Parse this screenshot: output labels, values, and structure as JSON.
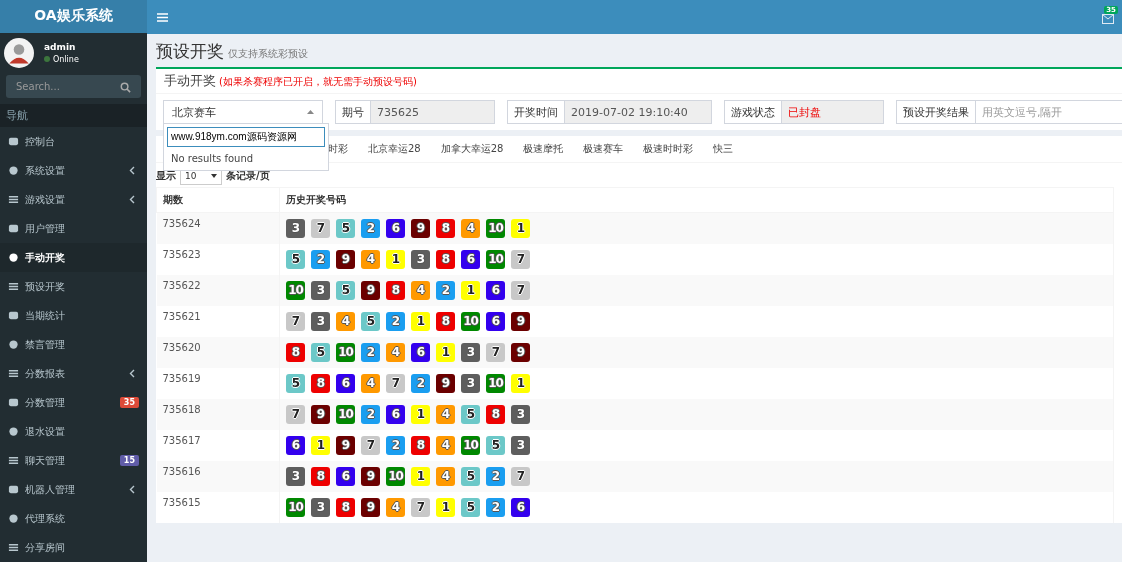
{
  "app": {
    "logo": "OA娱乐系统",
    "mail_badge": "35"
  },
  "user": {
    "name": "admin",
    "status": "Online"
  },
  "sidebar": {
    "search_placeholder": "Search...",
    "heading": "导航",
    "items": [
      {
        "label": "控制台",
        "selected": false,
        "submenu": false
      },
      {
        "label": "系统设置",
        "selected": false,
        "submenu": true
      },
      {
        "label": "游戏设置",
        "selected": false,
        "submenu": true
      },
      {
        "label": "用户管理",
        "selected": false,
        "submenu": false
      },
      {
        "label": "手动开奖",
        "selected": true,
        "submenu": false
      },
      {
        "label": "预设开奖",
        "selected": false,
        "submenu": false
      },
      {
        "label": "当期统计",
        "selected": false,
        "submenu": false
      },
      {
        "label": "禁言管理",
        "selected": false,
        "submenu": false
      },
      {
        "label": "分数报表",
        "selected": false,
        "submenu": true
      },
      {
        "label": "分数管理",
        "selected": false,
        "submenu": false,
        "badge": "35",
        "color": "#dd4b39"
      },
      {
        "label": "退水设置",
        "selected": false,
        "submenu": false
      },
      {
        "label": "聊天管理",
        "selected": false,
        "submenu": false,
        "badge": "15",
        "color": "#605ca8"
      },
      {
        "label": "机器人管理",
        "selected": false,
        "submenu": true
      },
      {
        "label": "代理系统",
        "selected": false,
        "submenu": false
      },
      {
        "label": "分享房间",
        "selected": false,
        "submenu": false
      }
    ]
  },
  "page": {
    "title": "预设开奖",
    "subtitle": "仅支持系统彩预设"
  },
  "box": {
    "title": "手动开奖",
    "note": "(如果杀赛程序已开启，就无需手动预设号码)",
    "game_select": {
      "value": "北京赛车",
      "expanded": true,
      "search_value": "www.918ym.com源码资源网",
      "empty_text": "No results found"
    },
    "fields": [
      {
        "label": "期号",
        "value": "735625",
        "kind": "readonly"
      },
      {
        "label": "开奖时间",
        "value": "2019-07-02 19:10:40",
        "kind": "readonly"
      },
      {
        "label": "游戏状态",
        "value": "已封盘",
        "kind": "status"
      },
      {
        "label": "预设开奖结果",
        "placeholder": "用英文逗号,隔开",
        "kind": "input"
      }
    ]
  },
  "tabs": [
    "时彩",
    "北京幸运28",
    "加拿大幸运28",
    "极速摩托",
    "极速赛车",
    "极速时时彩",
    "快三"
  ],
  "page_size": {
    "prefix": "显示",
    "value": "10",
    "suffix": "条记录/页"
  },
  "table": {
    "columns": [
      "期数",
      "历史开奖号码"
    ],
    "rows": [
      {
        "period": "735624",
        "balls": [
          {
            "n": "3",
            "color": "#5e5e5e"
          },
          {
            "n": "7",
            "color": "#c8c8c8"
          },
          {
            "n": "5",
            "color": "#6cc8c8"
          },
          {
            "n": "2",
            "color": "#1a9ef0"
          },
          {
            "n": "6",
            "color": "#3300ee"
          },
          {
            "n": "9",
            "color": "#6b0000"
          },
          {
            "n": "8",
            "color": "#ee0000"
          },
          {
            "n": "4",
            "color": "#ff9900"
          },
          {
            "n": "10",
            "color": "#008800"
          },
          {
            "n": "1",
            "color": "#ffff00"
          }
        ]
      },
      {
        "period": "735623",
        "balls": [
          {
            "n": "5",
            "color": "#6cc8c8"
          },
          {
            "n": "2",
            "color": "#1a9ef0"
          },
          {
            "n": "9",
            "color": "#6b0000"
          },
          {
            "n": "4",
            "color": "#ff9900"
          },
          {
            "n": "1",
            "color": "#ffff00"
          },
          {
            "n": "3",
            "color": "#5e5e5e"
          },
          {
            "n": "8",
            "color": "#ee0000"
          },
          {
            "n": "6",
            "color": "#3300ee"
          },
          {
            "n": "10",
            "color": "#008800"
          },
          {
            "n": "7",
            "color": "#c8c8c8"
          }
        ]
      },
      {
        "period": "735622",
        "balls": [
          {
            "n": "10",
            "color": "#008800"
          },
          {
            "n": "3",
            "color": "#5e5e5e"
          },
          {
            "n": "5",
            "color": "#6cc8c8"
          },
          {
            "n": "9",
            "color": "#6b0000"
          },
          {
            "n": "8",
            "color": "#ee0000"
          },
          {
            "n": "4",
            "color": "#ff9900"
          },
          {
            "n": "2",
            "color": "#1a9ef0"
          },
          {
            "n": "1",
            "color": "#ffff00"
          },
          {
            "n": "6",
            "color": "#3300ee"
          },
          {
            "n": "7",
            "color": "#c8c8c8"
          }
        ]
      },
      {
        "period": "735621",
        "balls": [
          {
            "n": "7",
            "color": "#c8c8c8"
          },
          {
            "n": "3",
            "color": "#5e5e5e"
          },
          {
            "n": "4",
            "color": "#ff9900"
          },
          {
            "n": "5",
            "color": "#6cc8c8"
          },
          {
            "n": "2",
            "color": "#1a9ef0"
          },
          {
            "n": "1",
            "color": "#ffff00"
          },
          {
            "n": "8",
            "color": "#ee0000"
          },
          {
            "n": "10",
            "color": "#008800"
          },
          {
            "n": "6",
            "color": "#3300ee"
          },
          {
            "n": "9",
            "color": "#6b0000"
          }
        ]
      },
      {
        "period": "735620",
        "balls": [
          {
            "n": "8",
            "color": "#ee0000"
          },
          {
            "n": "5",
            "color": "#6cc8c8"
          },
          {
            "n": "10",
            "color": "#008800"
          },
          {
            "n": "2",
            "color": "#1a9ef0"
          },
          {
            "n": "4",
            "color": "#ff9900"
          },
          {
            "n": "6",
            "color": "#3300ee"
          },
          {
            "n": "1",
            "color": "#ffff00"
          },
          {
            "n": "3",
            "color": "#5e5e5e"
          },
          {
            "n": "7",
            "color": "#c8c8c8"
          },
          {
            "n": "9",
            "color": "#6b0000"
          }
        ]
      },
      {
        "period": "735619",
        "balls": [
          {
            "n": "5",
            "color": "#6cc8c8"
          },
          {
            "n": "8",
            "color": "#ee0000"
          },
          {
            "n": "6",
            "color": "#3300ee"
          },
          {
            "n": "4",
            "color": "#ff9900"
          },
          {
            "n": "7",
            "color": "#c8c8c8"
          },
          {
            "n": "2",
            "color": "#1a9ef0"
          },
          {
            "n": "9",
            "color": "#6b0000"
          },
          {
            "n": "3",
            "color": "#5e5e5e"
          },
          {
            "n": "10",
            "color": "#008800"
          },
          {
            "n": "1",
            "color": "#ffff00"
          }
        ]
      },
      {
        "period": "735618",
        "balls": [
          {
            "n": "7",
            "color": "#c8c8c8"
          },
          {
            "n": "9",
            "color": "#6b0000"
          },
          {
            "n": "10",
            "color": "#008800"
          },
          {
            "n": "2",
            "color": "#1a9ef0"
          },
          {
            "n": "6",
            "color": "#3300ee"
          },
          {
            "n": "1",
            "color": "#ffff00"
          },
          {
            "n": "4",
            "color": "#ff9900"
          },
          {
            "n": "5",
            "color": "#6cc8c8"
          },
          {
            "n": "8",
            "color": "#ee0000"
          },
          {
            "n": "3",
            "color": "#5e5e5e"
          }
        ]
      },
      {
        "period": "735617",
        "balls": [
          {
            "n": "6",
            "color": "#3300ee"
          },
          {
            "n": "1",
            "color": "#ffff00"
          },
          {
            "n": "9",
            "color": "#6b0000"
          },
          {
            "n": "7",
            "color": "#c8c8c8"
          },
          {
            "n": "2",
            "color": "#1a9ef0"
          },
          {
            "n": "8",
            "color": "#ee0000"
          },
          {
            "n": "4",
            "color": "#ff9900"
          },
          {
            "n": "10",
            "color": "#008800"
          },
          {
            "n": "5",
            "color": "#6cc8c8"
          },
          {
            "n": "3",
            "color": "#5e5e5e"
          }
        ]
      },
      {
        "period": "735616",
        "balls": [
          {
            "n": "3",
            "color": "#5e5e5e"
          },
          {
            "n": "8",
            "color": "#ee0000"
          },
          {
            "n": "6",
            "color": "#3300ee"
          },
          {
            "n": "9",
            "color": "#6b0000"
          },
          {
            "n": "10",
            "color": "#008800"
          },
          {
            "n": "1",
            "color": "#ffff00"
          },
          {
            "n": "4",
            "color": "#ff9900"
          },
          {
            "n": "5",
            "color": "#6cc8c8"
          },
          {
            "n": "2",
            "color": "#1a9ef0"
          },
          {
            "n": "7",
            "color": "#c8c8c8"
          }
        ]
      },
      {
        "period": "735615",
        "balls": [
          {
            "n": "10",
            "color": "#008800"
          },
          {
            "n": "3",
            "color": "#5e5e5e"
          },
          {
            "n": "8",
            "color": "#ee0000"
          },
          {
            "n": "9",
            "color": "#6b0000"
          },
          {
            "n": "4",
            "color": "#ff9900"
          },
          {
            "n": "7",
            "color": "#c8c8c8"
          },
          {
            "n": "1",
            "color": "#ffff00"
          },
          {
            "n": "5",
            "color": "#6cc8c8"
          },
          {
            "n": "2",
            "color": "#1a9ef0"
          },
          {
            "n": "6",
            "color": "#3300ee"
          }
        ]
      }
    ]
  }
}
